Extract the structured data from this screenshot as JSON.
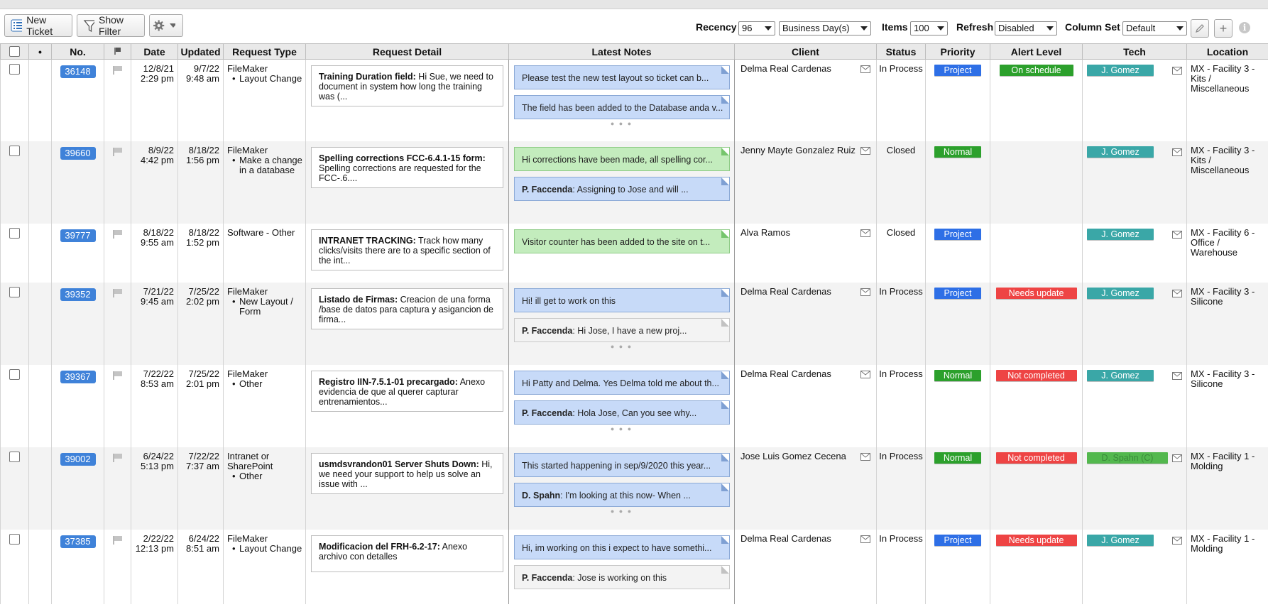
{
  "toolbar": {
    "new_ticket": "New Ticket",
    "show_filter": "Show Filter",
    "recency_label": "Recency",
    "recency_value": "96",
    "recency_unit": "Business Day(s)",
    "items_label": "Items",
    "items_value": "100",
    "refresh_label": "Refresh",
    "refresh_value": "Disabled",
    "column_set_label": "Column Set",
    "column_set_value": "Default"
  },
  "columns": [
    "",
    "•",
    "No.",
    "",
    "Date",
    "Updated",
    "Request Type",
    "Request Detail",
    "Latest Notes",
    "Client",
    "Status",
    "Priority",
    "Alert Level",
    "Tech",
    "Location"
  ],
  "colors": {
    "project": "#2e6fe6",
    "normal": "#2ca02c",
    "on_schedule": "#2ca02c",
    "alert_red": "#ee4444",
    "tech": "#3aa7a7",
    "ticket": "#3f82d9"
  },
  "rows": [
    {
      "no": "36148",
      "date": "12/8/21",
      "date_time": "2:29 pm",
      "updated": "9/7/22",
      "updated_time": "9:48 am",
      "req_type": "FileMaker",
      "req_sub": "Layout Change",
      "detail_title": "Training Duration field:",
      "detail_text": " Hi Sue, we need to document in system how long the training was (...",
      "notes": [
        {
          "author": "",
          "text": "Please test the new test layout so ticket can b..."
        },
        {
          "author": "",
          "text": "The field has been added to the Database anda v..."
        }
      ],
      "client": "Delma Real Cardenas",
      "status": "In Process",
      "priority": "Project",
      "alert": "On schedule",
      "tech": "J. Gomez",
      "location": "MX - Facility 3 - Kits / Miscellaneous"
    },
    {
      "no": "39660",
      "date": "8/9/22",
      "date_time": "4:42 pm",
      "updated": "8/18/22",
      "updated_time": "1:56 pm",
      "req_type": "FileMaker",
      "req_sub": "Make a change in a database",
      "detail_title": "Spelling corrections FCC-6.4.1-15 form:",
      "detail_text": " Spelling corrections are requested for the FCC-.6....",
      "notes": [
        {
          "author": "",
          "text": "Hi corrections have been made, all spelling cor..."
        },
        {
          "author": "P. Faccenda",
          "text": ": Assigning to Jose and will ..."
        }
      ],
      "client": "Jenny Mayte Gonzalez Ruiz",
      "status": "Closed",
      "priority": "Normal",
      "alert": "",
      "tech": "J. Gomez",
      "location": "MX - Facility 3 - Kits / Miscellaneous"
    },
    {
      "no": "39777",
      "date": "8/18/22",
      "date_time": "9:55 am",
      "updated": "8/18/22",
      "updated_time": "1:52 pm",
      "req_type": "Software - Other",
      "req_sub": "",
      "detail_title": "INTRANET TRACKING:",
      "detail_text": " Track how many clicks/visits there are to a specific section of the int...",
      "notes": [
        {
          "author": "",
          "text": "Visitor counter has been added to the site on t..."
        }
      ],
      "client": "Alva Ramos",
      "status": "Closed",
      "priority": "Project",
      "alert": "",
      "tech": "J. Gomez",
      "location": "MX - Facility 6 - Office / Warehouse"
    },
    {
      "no": "39352",
      "date": "7/21/22",
      "date_time": "9:45 am",
      "updated": "7/25/22",
      "updated_time": "2:02 pm",
      "req_type": "FileMaker",
      "req_sub": "New Layout / Form",
      "detail_title": "Listado de Firmas:",
      "detail_text": " Creacion de una forma /base de datos para captura y asigancion de firma...",
      "notes": [
        {
          "author": "",
          "text": "Hi! ill get to work on this"
        },
        {
          "author": "P. Faccenda",
          "text": ": Hi Jose, I have a new proj..."
        }
      ],
      "client": "Delma Real Cardenas",
      "status": "In Process",
      "priority": "Project",
      "alert": "Needs update",
      "tech": "J. Gomez",
      "location": "MX - Facility 3 - Silicone"
    },
    {
      "no": "39367",
      "date": "7/22/22",
      "date_time": "8:53 am",
      "updated": "7/25/22",
      "updated_time": "2:01 pm",
      "req_type": "FileMaker",
      "req_sub": "Other",
      "detail_title": "Registro IIN-7.5.1-01 precargado:",
      "detail_text": " Anexo evidencia de que al querer capturar entrenamientos...",
      "notes": [
        {
          "author": "",
          "text": "Hi Patty and Delma. Yes Delma told me about th..."
        },
        {
          "author": "P. Faccenda",
          "text": ": Hola Jose, Can you see why..."
        }
      ],
      "client": "Delma Real Cardenas",
      "status": "In Process",
      "priority": "Normal",
      "alert": "Not completed",
      "tech": "J. Gomez",
      "location": "MX - Facility 3 - Silicone"
    },
    {
      "no": "39002",
      "date": "6/24/22",
      "date_time": "5:13 pm",
      "updated": "7/22/22",
      "updated_time": "7:37 am",
      "req_type": "Intranet or SharePoint",
      "req_sub": "Other",
      "detail_title": "usmdsvrandon01 Server Shuts Down:",
      "detail_text": " Hi, we need your support to help us solve an issue with ...",
      "notes": [
        {
          "author": "",
          "text": "This started happening in sep/9/2020 this year..."
        },
        {
          "author": "D. Spahn",
          "text": ": I'm looking at this now- When ..."
        }
      ],
      "client": "Jose Luis Gomez Cecena",
      "status": "In Process",
      "priority": "Normal",
      "alert": "Not completed",
      "tech": "D. Spahn (C)",
      "location": "MX - Facility 1 - Molding"
    },
    {
      "no": "37385",
      "date": "2/22/22",
      "date_time": "12:13 pm",
      "updated": "6/24/22",
      "updated_time": "8:51 am",
      "req_type": "FileMaker",
      "req_sub": "Layout Change",
      "detail_title": "Modificacion del FRH-6.2-17:",
      "detail_text": " Anexo archivo con detalles",
      "notes": [
        {
          "author": "",
          "text": "Hi, im working on this i expect to have somethi..."
        },
        {
          "author": "P. Faccenda",
          "text": ": Jose is working on this"
        }
      ],
      "client": "Delma Real Cardenas",
      "status": "In Process",
      "priority": "Project",
      "alert": "Needs update",
      "tech": "J. Gomez",
      "location": "MX - Facility 1 - Molding"
    }
  ]
}
